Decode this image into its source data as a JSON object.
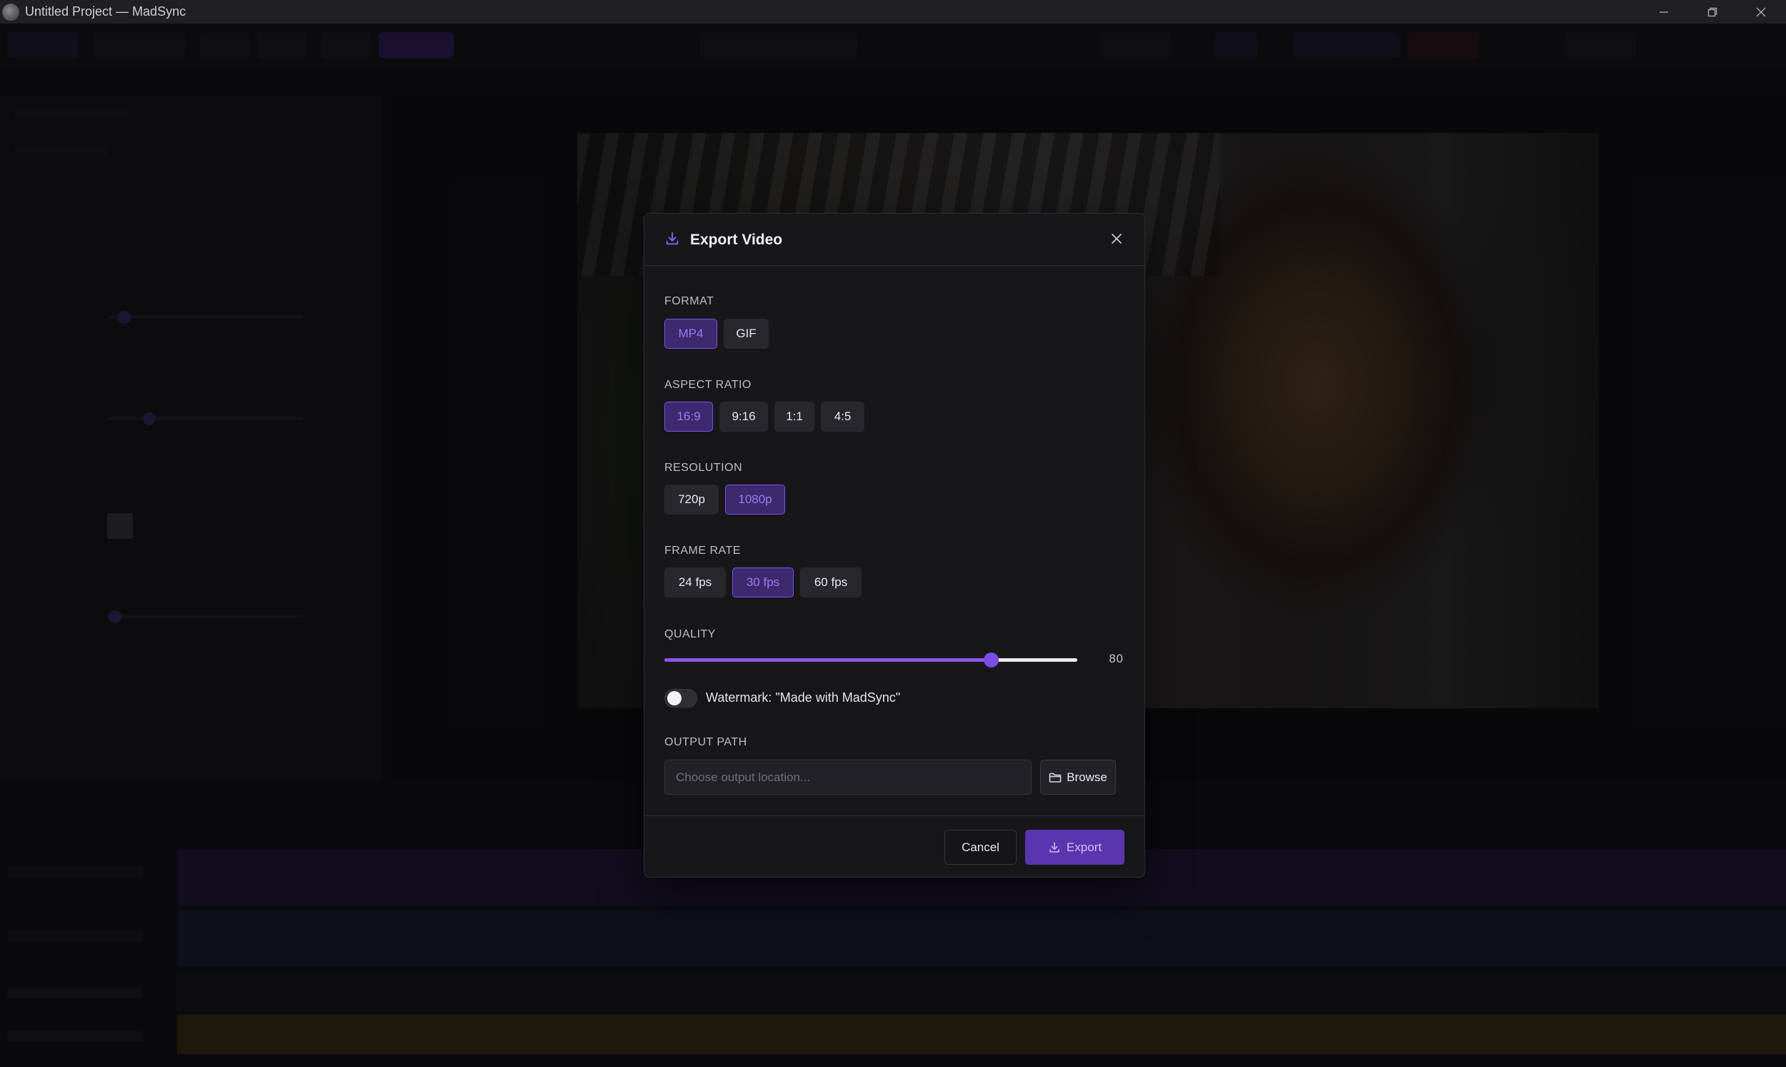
{
  "window": {
    "title": "Untitled Project — MadSync"
  },
  "colors": {
    "accent": "#7c4de6",
    "accent_selected_bg": "#3d2a6e",
    "accent_selected_text": "#9d79f2",
    "modal_bg": "#17171a"
  },
  "modal": {
    "title": "Export Video",
    "header_icon": "download-icon",
    "close_icon": "close-icon",
    "format": {
      "label": "FORMAT",
      "options": [
        "MP4",
        "GIF"
      ],
      "selected": "MP4"
    },
    "aspect_ratio": {
      "label": "ASPECT RATIO",
      "options": [
        "16:9",
        "9:16",
        "1:1",
        "4:5"
      ],
      "selected": "16:9"
    },
    "resolution": {
      "label": "RESOLUTION",
      "options": [
        "720p",
        "1080p"
      ],
      "selected": "1080p"
    },
    "frame_rate": {
      "label": "FRAME RATE",
      "options": [
        "24 fps",
        "30 fps",
        "60 fps"
      ],
      "selected": "30 fps"
    },
    "quality": {
      "label": "QUALITY",
      "value": 80,
      "value_text": "80",
      "slider_fraction": 0.79
    },
    "watermark": {
      "label": "Watermark: \"Made with MadSync\"",
      "enabled": false
    },
    "output_path": {
      "label": "OUTPUT PATH",
      "value": "",
      "placeholder": "Choose output location...",
      "browse_label": "Browse",
      "browse_icon": "folder-icon"
    },
    "cancel_label": "Cancel",
    "export_label": "Export",
    "export_icon": "download-icon"
  }
}
